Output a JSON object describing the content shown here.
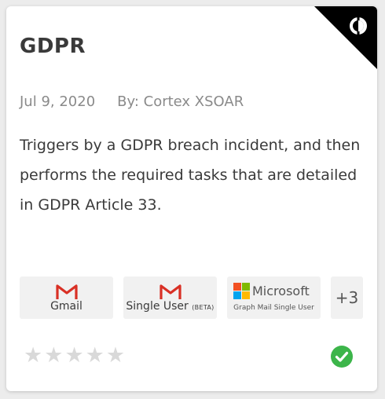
{
  "card": {
    "title": "GDPR",
    "date": "Jul 9, 2020",
    "author": "By: Cortex XSOAR",
    "description": "Triggers by a GDPR breach incident, and then performs the required tasks that are detailed in GDPR Article 33."
  },
  "integrations": {
    "gmail_label": "Gmail",
    "single_user_label": "Single User",
    "single_user_beta": "(BETA)",
    "microsoft_label": "Microsoft",
    "microsoft_sub": "Graph Mail Single User",
    "more_count": "+3"
  },
  "rating": {
    "value": 0,
    "max": 5
  },
  "status": "verified",
  "icons": {
    "corner": "xsoar-logo-icon",
    "gmail": "gmail-icon",
    "microsoft": "microsoft-icon",
    "star": "star-icon",
    "check": "check-circle-icon"
  },
  "colors": {
    "gmail_red": "#d93025",
    "verified_green": "#3cb54a",
    "star_empty": "#d9d9d9",
    "ms_red": "#f25022",
    "ms_green": "#7fba00",
    "ms_blue": "#00a4ef",
    "ms_yellow": "#ffb900"
  }
}
